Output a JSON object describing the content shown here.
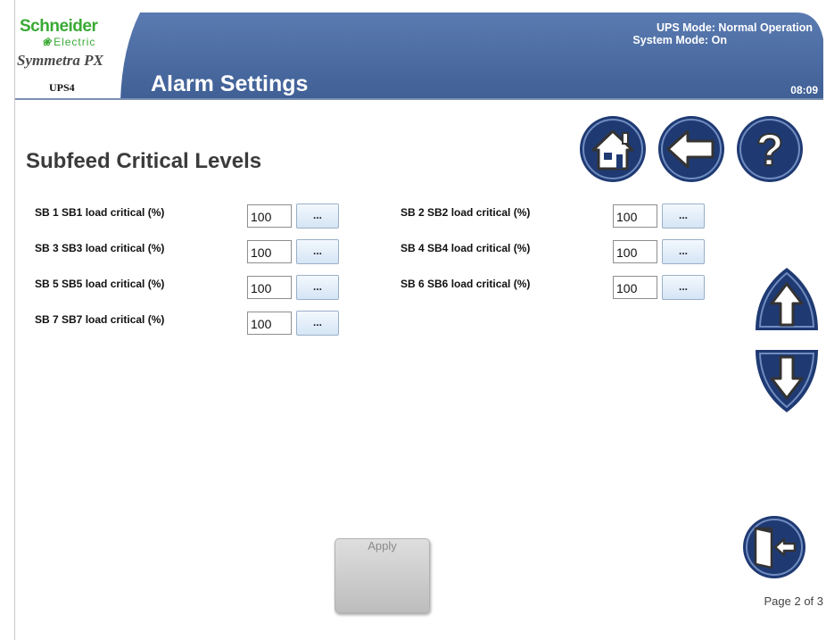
{
  "header": {
    "brand_name": "Schneider",
    "brand_sub": "Electric",
    "product": "Symmetra PX",
    "device": "UPS4",
    "title": "Alarm Settings",
    "ups_mode": "UPS Mode: Normal Operation",
    "system_mode": "System Mode: On",
    "time": "08:09"
  },
  "nav": {
    "home_icon": "home-icon",
    "back_icon": "back-arrow-icon",
    "help_icon": "help-icon",
    "up_icon": "scroll-up-icon",
    "down_icon": "scroll-down-icon",
    "exit_icon": "exit-door-icon"
  },
  "section_title": "Subfeed Critical Levels",
  "settings": [
    {
      "label": "SB 1 SB1 load critical (%)",
      "value": "100",
      "button": "..."
    },
    {
      "label": "SB 2 SB2 load critical (%)",
      "value": "100",
      "button": "..."
    },
    {
      "label": "SB 3 SB3 load critical (%)",
      "value": "100",
      "button": "..."
    },
    {
      "label": "SB 4 SB4 load critical (%)",
      "value": "100",
      "button": "..."
    },
    {
      "label": "SB 5 SB5 load critical (%)",
      "value": "100",
      "button": "..."
    },
    {
      "label": "SB 6 SB6 load critical (%)",
      "value": "100",
      "button": "..."
    },
    {
      "label": "SB 7 SB7 load critical (%)",
      "value": "100",
      "button": "..."
    }
  ],
  "apply_label": "Apply",
  "page_indicator": "Page 2 of 3",
  "colors": {
    "header_blue": "#4d6fa5",
    "brand_green": "#3aaa35",
    "button_navy": "#1f3a73"
  }
}
